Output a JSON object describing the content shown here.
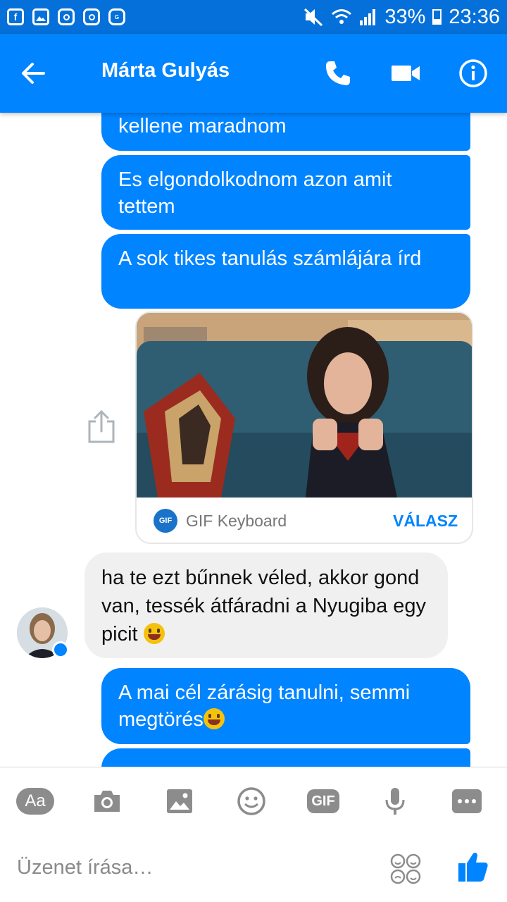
{
  "status_bar": {
    "battery": "33%",
    "time": "23:36",
    "icons": [
      "facebook-icon",
      "gallery-icon",
      "instagram-icon",
      "instagram-icon",
      "galaxy-app-icon",
      "mute-icon",
      "wifi-icon",
      "signal-icon",
      "battery-icon"
    ]
  },
  "header": {
    "contact_name": "Márta Gulyás",
    "icons": [
      "back-arrow-icon",
      "phone-icon",
      "video-camera-icon",
      "info-icon"
    ]
  },
  "messages": [
    {
      "from": "me",
      "text": "kellene maradnom"
    },
    {
      "from": "me",
      "text": "Es elgondolkodnom azon amit tettem"
    },
    {
      "from": "me",
      "text": "A sok tikes tanulás számlájára írd"
    },
    {
      "from": "me",
      "type": "gif",
      "source": "GIF Keyboard",
      "action": "VÁLASZ",
      "badge": "GIF"
    },
    {
      "from": "them",
      "text": "ha te ezt bűnnek véled, akkor gond van, tessék átfáradni a Nyugiba egy picit"
    },
    {
      "from": "me",
      "text": "A mai cél zárásig tanulni, semmi megtörés"
    }
  ],
  "composer": {
    "aa_label": "Aa",
    "gif_label": "GIF",
    "placeholder": "Üzenet írása…",
    "icons": [
      "camera-icon",
      "image-icon",
      "emoji-icon",
      "microphone-icon",
      "more-icon",
      "stickers-icon",
      "thumbs-up-icon"
    ]
  },
  "colors": {
    "status_bar": "#0570d9",
    "header": "#0084ff",
    "outgoing_bubble": "#0084ff",
    "incoming_bubble": "#f1f0f0"
  }
}
